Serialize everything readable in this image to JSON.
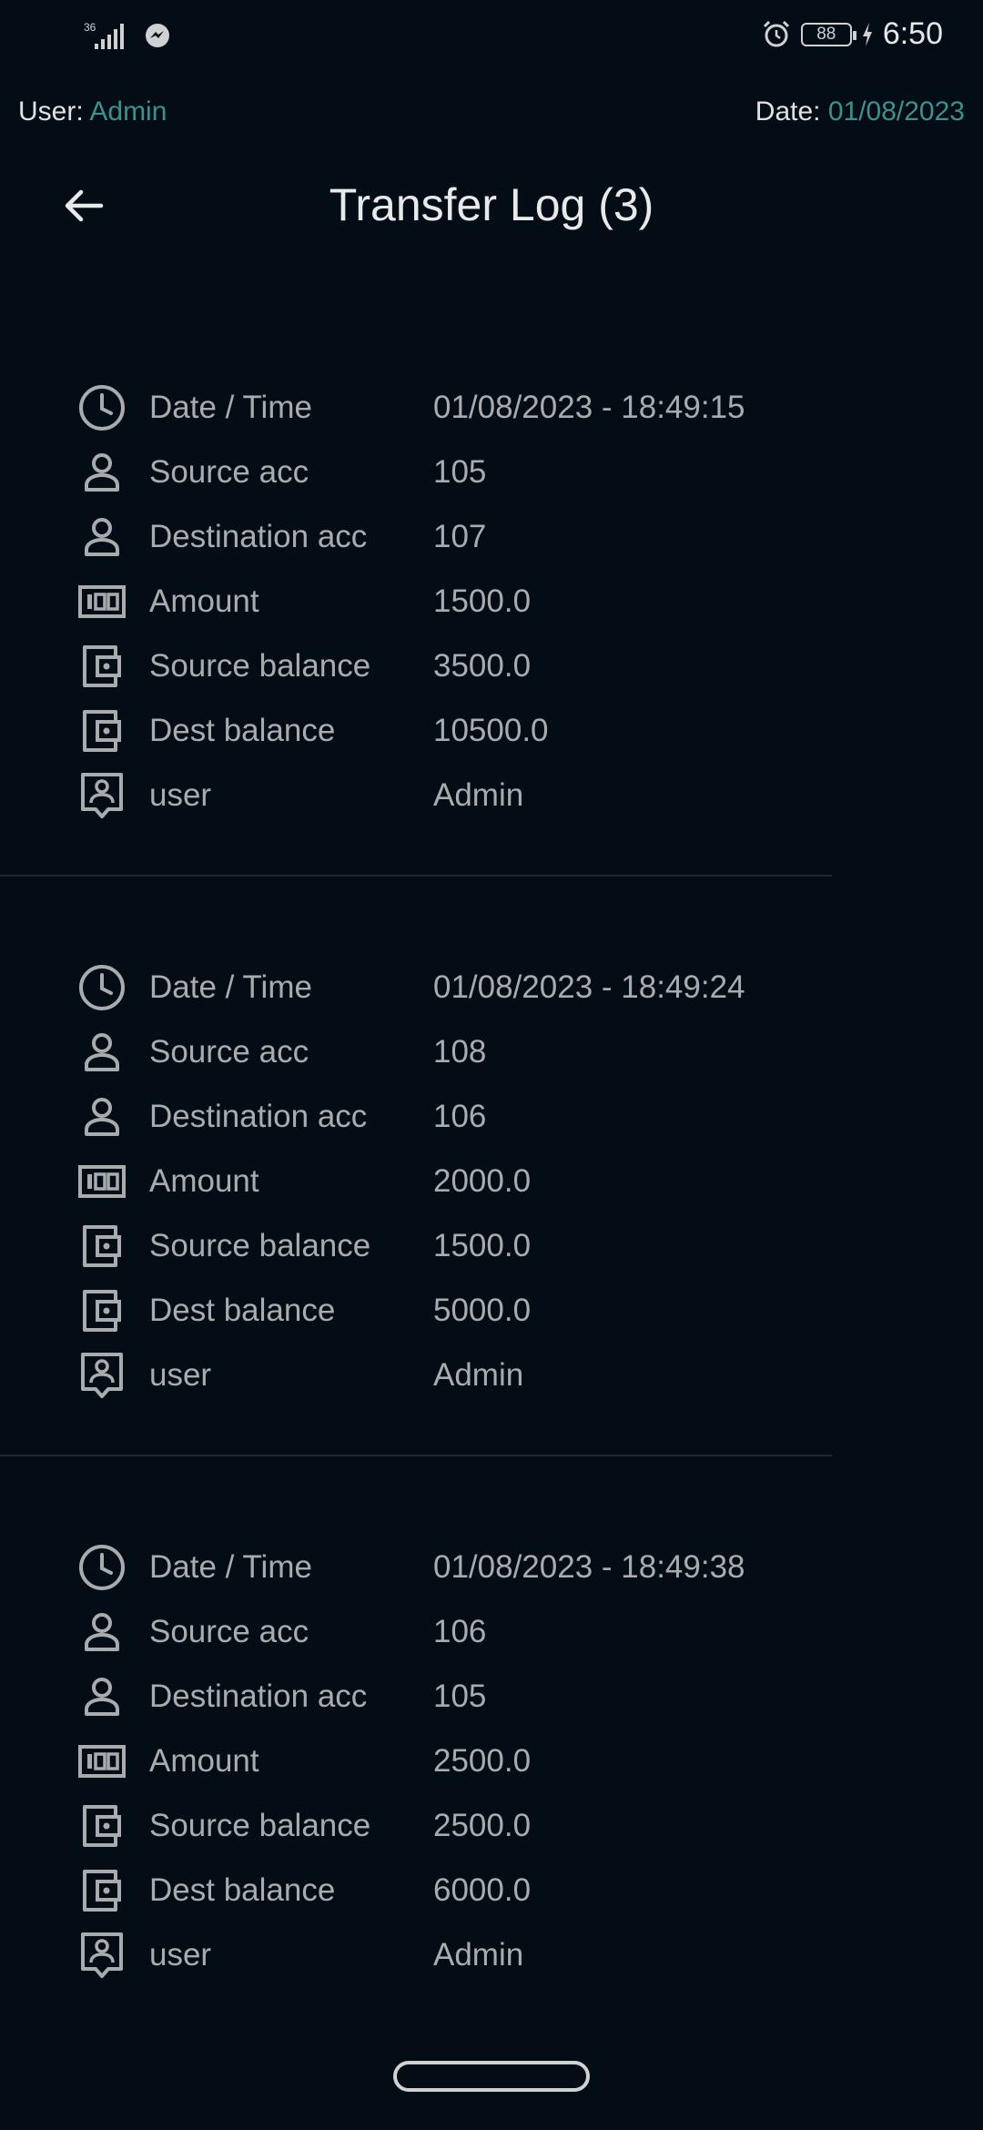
{
  "status_bar": {
    "network": "36",
    "battery": "88",
    "time": "6:50",
    "icons": [
      "signal-icon",
      "messenger-icon",
      "alarm-icon",
      "battery-icon",
      "charging-icon"
    ]
  },
  "meta": {
    "user_label": "User:",
    "user_value": "Admin",
    "date_label": "Date:",
    "date_value": "01/08/2023"
  },
  "header": {
    "title": "Transfer Log (3)"
  },
  "colors": {
    "background": "#040d16",
    "accent": "#3f8f8d",
    "text_muted": "#a9acaf"
  },
  "records": [
    {
      "fields": [
        {
          "icon": "clock-icon",
          "label": "Date / Time",
          "value": "01/08/2023 - 18:49:15"
        },
        {
          "icon": "person-icon",
          "label": "Source acc",
          "value": "105"
        },
        {
          "icon": "person-icon",
          "label": "Destination acc",
          "value": "107"
        },
        {
          "icon": "money-icon",
          "label": "Amount",
          "value": "1500.0"
        },
        {
          "icon": "wallet-icon",
          "label": "Source balance",
          "value": "3500.0"
        },
        {
          "icon": "wallet-icon",
          "label": "Dest balance",
          "value": "10500.0"
        },
        {
          "icon": "user-badge-icon",
          "label": "user",
          "value": "Admin"
        }
      ]
    },
    {
      "fields": [
        {
          "icon": "clock-icon",
          "label": "Date / Time",
          "value": "01/08/2023 - 18:49:24"
        },
        {
          "icon": "person-icon",
          "label": "Source acc",
          "value": "108"
        },
        {
          "icon": "person-icon",
          "label": "Destination acc",
          "value": "106"
        },
        {
          "icon": "money-icon",
          "label": "Amount",
          "value": "2000.0"
        },
        {
          "icon": "wallet-icon",
          "label": "Source balance",
          "value": "1500.0"
        },
        {
          "icon": "wallet-icon",
          "label": "Dest balance",
          "value": "5000.0"
        },
        {
          "icon": "user-badge-icon",
          "label": "user",
          "value": "Admin"
        }
      ]
    },
    {
      "fields": [
        {
          "icon": "clock-icon",
          "label": "Date / Time",
          "value": "01/08/2023 - 18:49:38"
        },
        {
          "icon": "person-icon",
          "label": "Source acc",
          "value": "106"
        },
        {
          "icon": "person-icon",
          "label": "Destination acc",
          "value": "105"
        },
        {
          "icon": "money-icon",
          "label": "Amount",
          "value": "2500.0"
        },
        {
          "icon": "wallet-icon",
          "label": "Source balance",
          "value": "2500.0"
        },
        {
          "icon": "wallet-icon",
          "label": "Dest balance",
          "value": "6000.0"
        },
        {
          "icon": "user-badge-icon",
          "label": "user",
          "value": "Admin"
        }
      ]
    }
  ]
}
